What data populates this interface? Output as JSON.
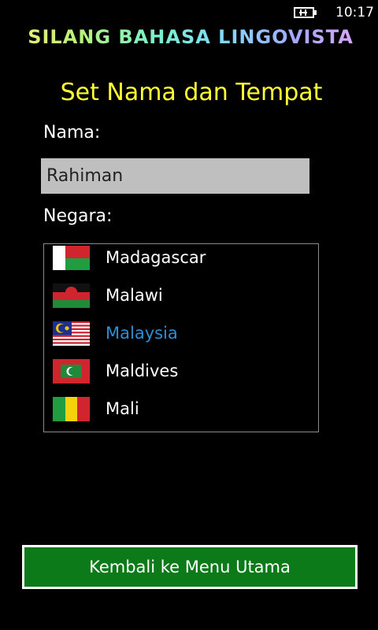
{
  "status_bar": {
    "time": "10:17",
    "battery_icon": "battery-charging-icon"
  },
  "app": {
    "title": "SILANG BAHASA LINGOVISTA"
  },
  "page": {
    "title": "Set Nama dan Tempat"
  },
  "name_field": {
    "label": "Nama:",
    "value": "Rahiman"
  },
  "country_field": {
    "label": "Negara:",
    "selected": "Malaysia",
    "items": [
      {
        "name": "Madagascar",
        "flag": "madagascar-flag-icon"
      },
      {
        "name": "Malawi",
        "flag": "malawi-flag-icon"
      },
      {
        "name": "Malaysia",
        "flag": "malaysia-flag-icon",
        "selected": true
      },
      {
        "name": "Maldives",
        "flag": "maldives-flag-icon"
      },
      {
        "name": "Mali",
        "flag": "mali-flag-icon"
      }
    ]
  },
  "actions": {
    "back_label": "Kembali ke Menu Utama"
  },
  "colors": {
    "background": "#000000",
    "page_title": "#ffff33",
    "selected_item": "#2b8fd6",
    "button": "#0d7a1a",
    "input_bg": "#bfbfbf"
  }
}
